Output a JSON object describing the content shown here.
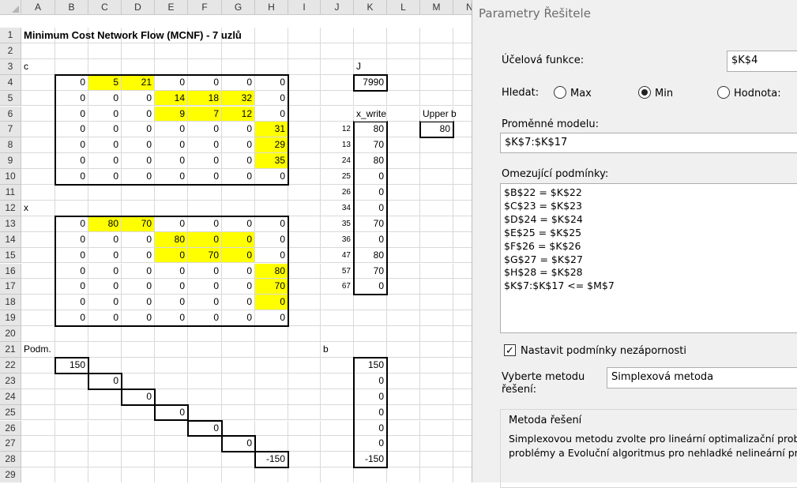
{
  "spreadsheet": {
    "columns": [
      "A",
      "B",
      "C",
      "D",
      "E",
      "F",
      "G",
      "H",
      "I",
      "J",
      "K",
      "L",
      "M",
      "N"
    ],
    "rows": [
      "1",
      "2",
      "3",
      "4",
      "5",
      "6",
      "7",
      "8",
      "9",
      "10",
      "11",
      "12",
      "13",
      "14",
      "15",
      "16",
      "17",
      "18",
      "19",
      "20",
      "21",
      "22",
      "23",
      "24",
      "25",
      "26",
      "27",
      "28",
      "29"
    ],
    "title": "Minimum Cost Network Flow (MCNF) - 7 uzlů",
    "label_c": "c",
    "label_x": "x",
    "label_podm": "Podm.",
    "label_J": "J",
    "label_b": "b",
    "label_xwrite": "x_write",
    "label_upper": "Upper b",
    "objective_value": "7990",
    "upper_value": "80",
    "matrix_c": [
      [
        "0",
        "5",
        "21",
        "0",
        "0",
        "0",
        "0"
      ],
      [
        "0",
        "0",
        "0",
        "14",
        "18",
        "32",
        "0"
      ],
      [
        "0",
        "0",
        "0",
        "9",
        "7",
        "12",
        "0"
      ],
      [
        "0",
        "0",
        "0",
        "0",
        "0",
        "0",
        "31"
      ],
      [
        "0",
        "0",
        "0",
        "0",
        "0",
        "0",
        "29"
      ],
      [
        "0",
        "0",
        "0",
        "0",
        "0",
        "0",
        "35"
      ],
      [
        "0",
        "0",
        "0",
        "0",
        "0",
        "0",
        "0"
      ]
    ],
    "matrix_x": [
      [
        "0",
        "80",
        "70",
        "0",
        "0",
        "0",
        "0"
      ],
      [
        "0",
        "0",
        "0",
        "80",
        "0",
        "0",
        "0"
      ],
      [
        "0",
        "0",
        "0",
        "0",
        "70",
        "0",
        "0"
      ],
      [
        "0",
        "0",
        "0",
        "0",
        "0",
        "0",
        "80"
      ],
      [
        "0",
        "0",
        "0",
        "0",
        "0",
        "0",
        "70"
      ],
      [
        "0",
        "0",
        "0",
        "0",
        "0",
        "0",
        "0"
      ],
      [
        "0",
        "0",
        "0",
        "0",
        "0",
        "0",
        "0"
      ]
    ],
    "edge_labels": [
      "12",
      "13",
      "24",
      "25",
      "26",
      "34",
      "35",
      "36",
      "47",
      "57",
      "67"
    ],
    "x_write": [
      "80",
      "70",
      "80",
      "0",
      "0",
      "0",
      "70",
      "0",
      "80",
      "70",
      "0"
    ],
    "podm": [
      "150",
      "0",
      "0",
      "0",
      "0",
      "0",
      "-150"
    ],
    "b_values": [
      "150",
      "0",
      "0",
      "0",
      "0",
      "0",
      "-150"
    ],
    "highlight_color": "#ffff00"
  },
  "dialog": {
    "title": "Parametry Řešitele",
    "objective_label": "Účelová funkce:",
    "objective_value": "$K$4",
    "seek_label": "Hledat:",
    "opt_max": "Max",
    "opt_min": "Min",
    "opt_value": "Hodnota:",
    "selected": "Min",
    "vars_label": "Proměnné modelu:",
    "vars_value": "$K$7:$K$17",
    "constraints_label": "Omezující podmínky:",
    "constraints": [
      "$B$22 = $K$22",
      "$C$23 = $K$23",
      "$D$24 = $K$24",
      "$E$25 = $K$25",
      "$F$26 = $K$26",
      "$G$27 = $K$27",
      "$H$28 = $K$28",
      "$K$7:$K$17 <= $M$7"
    ],
    "nonneg_label": "Nastavit podmínky nezápornosti",
    "nonneg_checked": true,
    "method_label_1": "Vyberte metodu",
    "method_label_2": "řešení:",
    "method_value": "Simplexová metoda",
    "method_group_title": "Metoda řešení",
    "method_desc_1": "Simplexovou metodu zvolte pro lineární optimalizační problém",
    "method_desc_2": "problémy a Evoluční algoritmus pro nehladké nelineární proble"
  }
}
